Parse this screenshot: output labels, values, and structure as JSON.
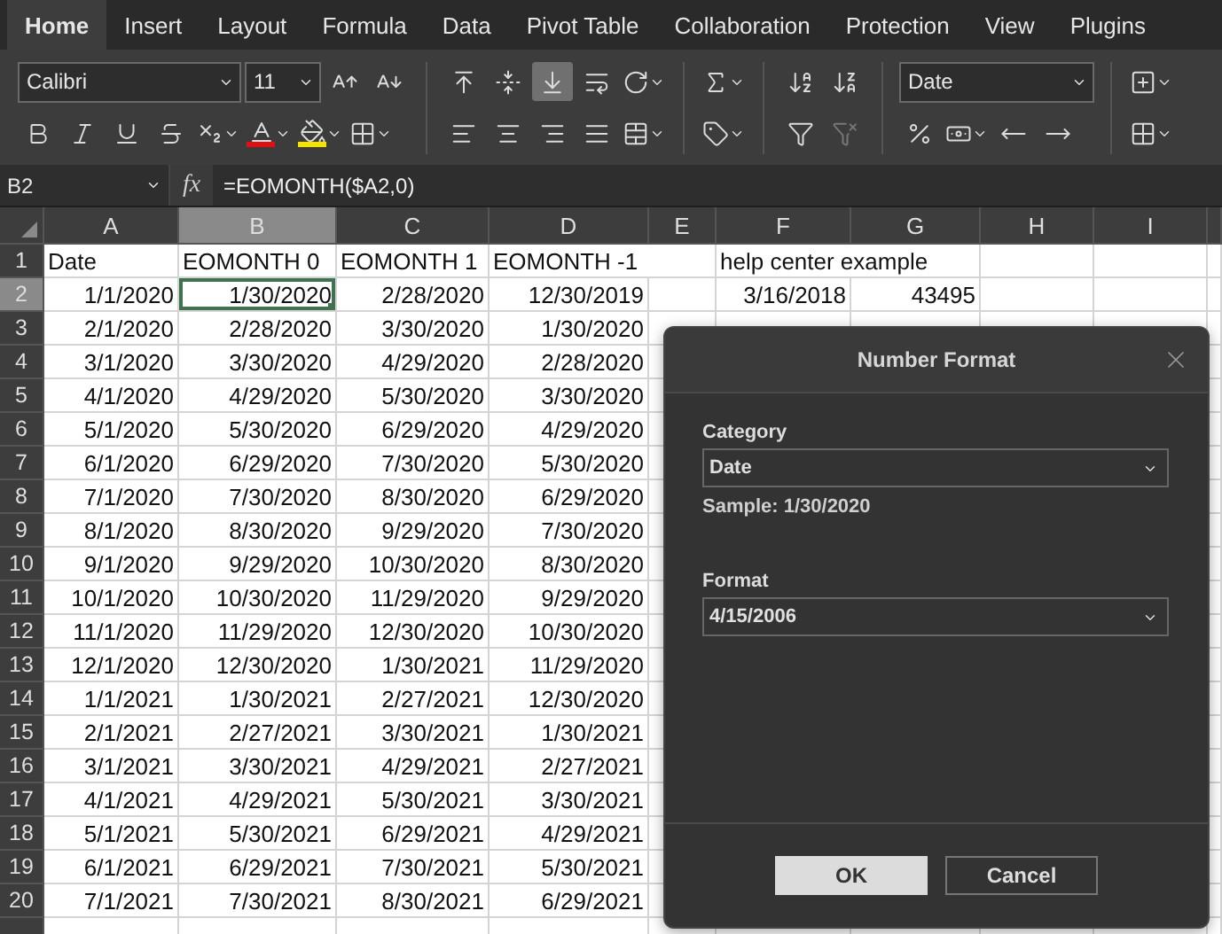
{
  "tabs": [
    {
      "label": "Home",
      "selected": true
    },
    {
      "label": "Insert",
      "selected": false
    },
    {
      "label": "Layout",
      "selected": false
    },
    {
      "label": "Formula",
      "selected": false
    },
    {
      "label": "Data",
      "selected": false
    },
    {
      "label": "Pivot Table",
      "selected": false
    },
    {
      "label": "Collaboration",
      "selected": false
    },
    {
      "label": "Protection",
      "selected": false
    },
    {
      "label": "View",
      "selected": false
    },
    {
      "label": "Plugins",
      "selected": false
    }
  ],
  "toolbar": {
    "font_name": "Calibri",
    "font_size": "11",
    "vertical_align_buttons": [
      {
        "selected": false
      },
      {
        "selected": false
      },
      {
        "selected": true
      }
    ],
    "clear_filter_disabled": true,
    "number_format": "Date"
  },
  "formula_bar": {
    "cell_reference": "B2",
    "fx": "fx",
    "formula": "=EOMONTH($A2,0)"
  },
  "sheet": {
    "columns": [
      {
        "label": "A",
        "selected": false
      },
      {
        "label": "B",
        "selected": true
      },
      {
        "label": "C",
        "selected": false
      },
      {
        "label": "D",
        "selected": false
      },
      {
        "label": "E",
        "selected": false
      },
      {
        "label": "F",
        "selected": false
      },
      {
        "label": "G",
        "selected": false
      },
      {
        "label": "H",
        "selected": false
      },
      {
        "label": "I",
        "selected": false
      }
    ],
    "rows": [
      {
        "number": "1",
        "selected": false,
        "kind": "label",
        "cells": [
          "Date",
          "EOMONTH 0",
          "EOMONTH 1",
          "EOMONTH -1",
          null,
          "help center example",
          null,
          null,
          null
        ]
      },
      {
        "number": "2",
        "selected": true,
        "kind": "value",
        "cells": [
          "1/1/2020",
          "1/30/2020",
          "2/28/2020",
          "12/30/2019",
          null,
          "3/16/2018",
          "43495",
          null,
          null
        ]
      },
      {
        "number": "3",
        "selected": false,
        "kind": "value",
        "cells": [
          "2/1/2020",
          "2/28/2020",
          "3/30/2020",
          "1/30/2020",
          null,
          null,
          null,
          null,
          null
        ]
      },
      {
        "number": "4",
        "selected": false,
        "kind": "value",
        "cells": [
          "3/1/2020",
          "3/30/2020",
          "4/29/2020",
          "2/28/2020",
          null,
          null,
          null,
          null,
          null
        ]
      },
      {
        "number": "5",
        "selected": false,
        "kind": "value",
        "cells": [
          "4/1/2020",
          "4/29/2020",
          "5/30/2020",
          "3/30/2020",
          null,
          null,
          null,
          null,
          null
        ]
      },
      {
        "number": "6",
        "selected": false,
        "kind": "value",
        "cells": [
          "5/1/2020",
          "5/30/2020",
          "6/29/2020",
          "4/29/2020",
          null,
          null,
          null,
          null,
          null
        ]
      },
      {
        "number": "7",
        "selected": false,
        "kind": "value",
        "cells": [
          "6/1/2020",
          "6/29/2020",
          "7/30/2020",
          "5/30/2020",
          null,
          null,
          null,
          null,
          null
        ]
      },
      {
        "number": "8",
        "selected": false,
        "kind": "value",
        "cells": [
          "7/1/2020",
          "7/30/2020",
          "8/30/2020",
          "6/29/2020",
          null,
          null,
          null,
          null,
          null
        ]
      },
      {
        "number": "9",
        "selected": false,
        "kind": "value",
        "cells": [
          "8/1/2020",
          "8/30/2020",
          "9/29/2020",
          "7/30/2020",
          null,
          null,
          null,
          null,
          null
        ]
      },
      {
        "number": "10",
        "selected": false,
        "kind": "value",
        "cells": [
          "9/1/2020",
          "9/29/2020",
          "10/30/2020",
          "8/30/2020",
          null,
          null,
          null,
          null,
          null
        ]
      },
      {
        "number": "11",
        "selected": false,
        "kind": "value",
        "cells": [
          "10/1/2020",
          "10/30/2020",
          "11/29/2020",
          "9/29/2020",
          null,
          null,
          null,
          null,
          null
        ]
      },
      {
        "number": "12",
        "selected": false,
        "kind": "value",
        "cells": [
          "11/1/2020",
          "11/29/2020",
          "12/30/2020",
          "10/30/2020",
          null,
          null,
          null,
          null,
          null
        ]
      },
      {
        "number": "13",
        "selected": false,
        "kind": "value",
        "cells": [
          "12/1/2020",
          "12/30/2020",
          "1/30/2021",
          "11/29/2020",
          null,
          null,
          null,
          null,
          null
        ]
      },
      {
        "number": "14",
        "selected": false,
        "kind": "value",
        "cells": [
          "1/1/2021",
          "1/30/2021",
          "2/27/2021",
          "12/30/2020",
          null,
          null,
          null,
          null,
          null
        ]
      },
      {
        "number": "15",
        "selected": false,
        "kind": "value",
        "cells": [
          "2/1/2021",
          "2/27/2021",
          "3/30/2021",
          "1/30/2021",
          null,
          null,
          null,
          null,
          null
        ]
      },
      {
        "number": "16",
        "selected": false,
        "kind": "value",
        "cells": [
          "3/1/2021",
          "3/30/2021",
          "4/29/2021",
          "2/27/2021",
          null,
          null,
          null,
          null,
          null
        ]
      },
      {
        "number": "17",
        "selected": false,
        "kind": "value",
        "cells": [
          "4/1/2021",
          "4/29/2021",
          "5/30/2021",
          "3/30/2021",
          null,
          null,
          null,
          null,
          null
        ]
      },
      {
        "number": "18",
        "selected": false,
        "kind": "value",
        "cells": [
          "5/1/2021",
          "5/30/2021",
          "6/29/2021",
          "4/29/2021",
          null,
          null,
          null,
          null,
          null
        ]
      },
      {
        "number": "19",
        "selected": false,
        "kind": "value",
        "cells": [
          "6/1/2021",
          "6/29/2021",
          "7/30/2021",
          "5/30/2021",
          null,
          null,
          null,
          null,
          null
        ]
      },
      {
        "number": "20",
        "selected": false,
        "kind": "value",
        "cells": [
          "7/1/2021",
          "7/30/2021",
          "8/30/2021",
          "6/29/2021",
          null,
          null,
          null,
          null,
          null
        ]
      }
    ]
  },
  "dialog": {
    "title": "Number Format",
    "category_label": "Category",
    "category": "Date",
    "sample": "Sample: 1/30/2020",
    "format_label": "Format",
    "format": "4/15/2006",
    "buttons": [
      {
        "label": "OK",
        "kind": "primary"
      },
      {
        "label": "Cancel",
        "kind": "secondary"
      }
    ]
  }
}
